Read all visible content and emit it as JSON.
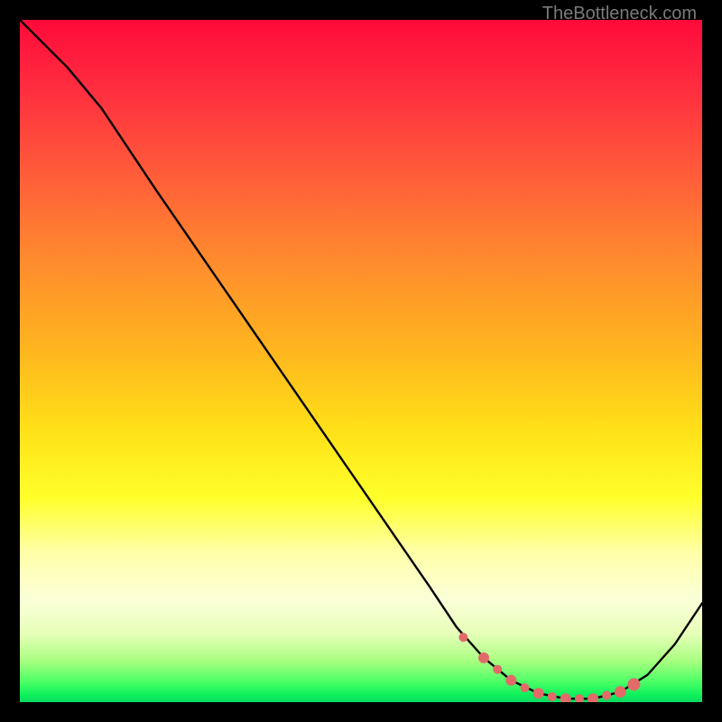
{
  "watermark": "TheBottleneck.com",
  "chart_data": {
    "type": "line",
    "title": "",
    "xlabel": "",
    "ylabel": "",
    "xlim": [
      0,
      100
    ],
    "ylim": [
      0,
      100
    ],
    "series": [
      {
        "name": "bottleneck-curve",
        "x": [
          0,
          7,
          12,
          20,
          30,
          40,
          50,
          60,
          64,
          68,
          72,
          76,
          80,
          84,
          88,
          92,
          96,
          100
        ],
        "values": [
          100,
          93,
          87,
          75,
          60.5,
          46,
          31.5,
          17,
          11,
          6.5,
          3.2,
          1.3,
          0.5,
          0.5,
          1.5,
          4,
          8.5,
          14.5
        ]
      }
    ],
    "markers": {
      "name": "highlight-points",
      "x": [
        65,
        68,
        70,
        72,
        74,
        76,
        78,
        80,
        82,
        84,
        86,
        88,
        90
      ],
      "values": [
        9.5,
        6.5,
        4.8,
        3.2,
        2.1,
        1.3,
        0.8,
        0.5,
        0.5,
        0.5,
        1.0,
        1.5,
        2.6
      ],
      "radii": [
        5,
        6,
        5,
        6,
        5,
        6,
        5,
        6,
        5,
        6,
        5,
        6.5,
        7
      ]
    }
  }
}
